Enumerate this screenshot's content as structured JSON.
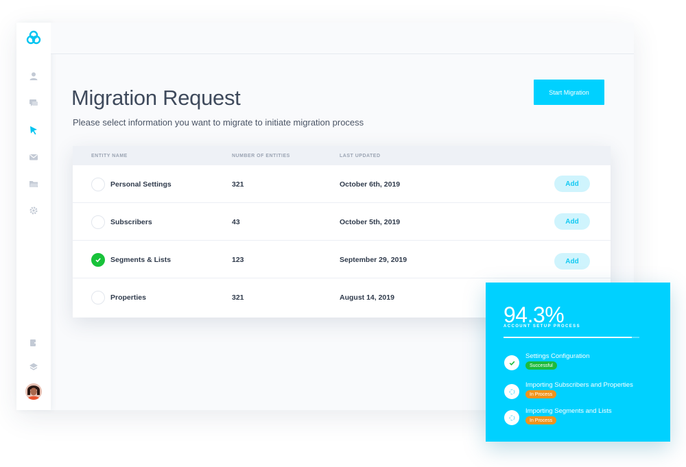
{
  "app": {
    "logo_icon": "trefoil-logo-icon",
    "accent_color": "#00d1ff"
  },
  "sidebar": {
    "items": [
      {
        "icon": "user-icon"
      },
      {
        "icon": "chat-icon"
      },
      {
        "icon": "cursor-icon",
        "active": true
      },
      {
        "icon": "mail-icon"
      },
      {
        "icon": "folder-icon"
      },
      {
        "icon": "gear-icon"
      }
    ],
    "bottom_items": [
      {
        "icon": "export-icon"
      },
      {
        "icon": "layers-icon"
      }
    ]
  },
  "page": {
    "title": "Migration Request",
    "subtitle": "Please select information you want to migrate to initiate migration process",
    "start_button": "Start Migration"
  },
  "table": {
    "columns": [
      "ENTITY NAME",
      "NUMBER OF ENTITIES",
      "LAST UPDATED"
    ],
    "rows": [
      {
        "name": "Personal Settings",
        "count": "321",
        "updated": "October 6th, 2019",
        "checked": false,
        "action": "Add"
      },
      {
        "name": "Subscribers",
        "count": "43",
        "updated": "October 5th, 2019",
        "checked": false,
        "action": "Add"
      },
      {
        "name": "Segments & Lists",
        "count": "123",
        "updated": "September 29, 2019",
        "checked": true,
        "action": "Add"
      },
      {
        "name": "Properties",
        "count": "321",
        "updated": "August 14, 2019",
        "checked": false,
        "action": ""
      }
    ]
  },
  "progress_card": {
    "percent": "94.3%",
    "progress_value": 0.943,
    "label": "ACCOUNT SETUP PROCESS",
    "steps": [
      {
        "label": "Settings Configuration",
        "status": "Successful",
        "state": "done"
      },
      {
        "label": "Importing Subscribers and Properties",
        "status": "In Process",
        "state": "in-process"
      },
      {
        "label": "Importing Segments and Lists",
        "status": "In Process",
        "state": "in-process"
      }
    ]
  }
}
